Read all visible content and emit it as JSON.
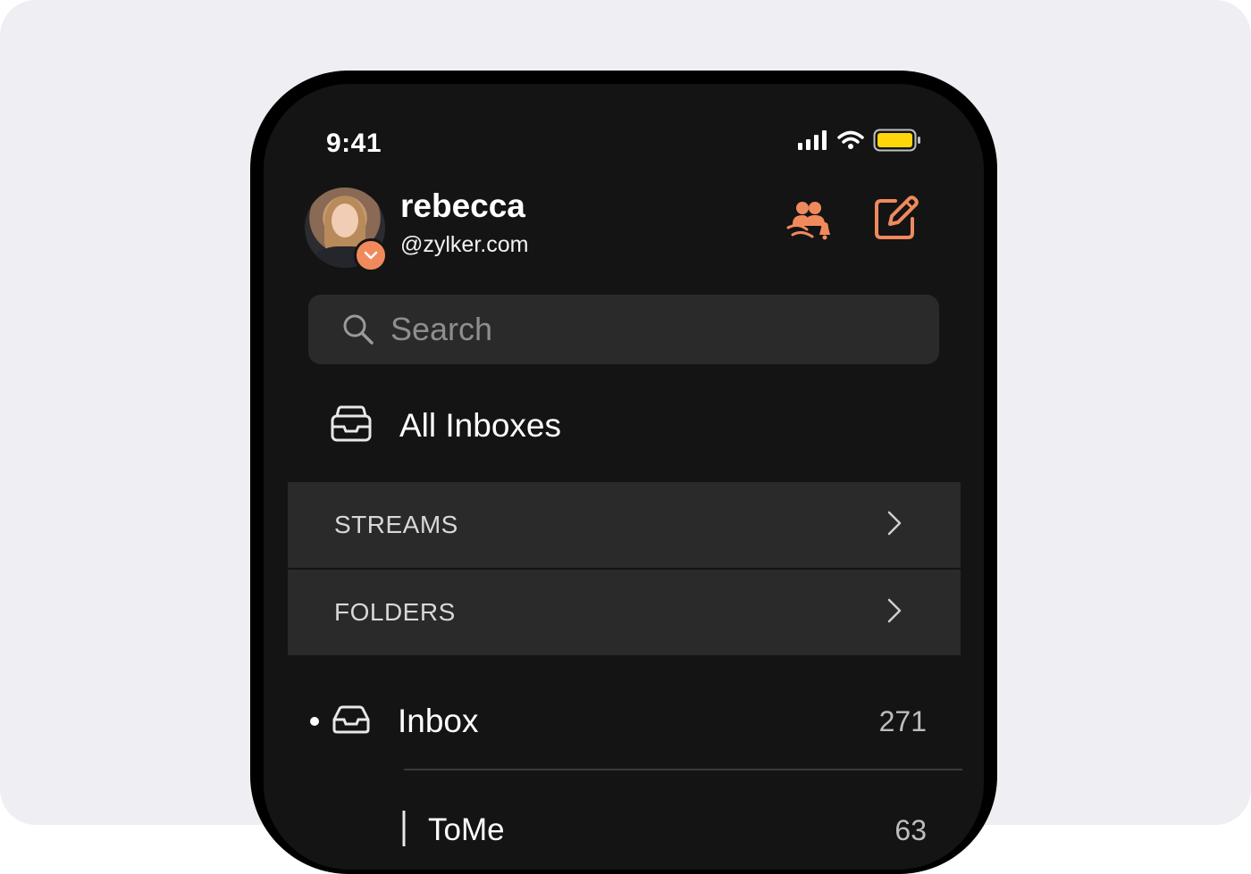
{
  "status_bar": {
    "time": "9:41"
  },
  "account": {
    "name": "rebecca",
    "domain": "@zylker.com"
  },
  "search": {
    "placeholder": "Search"
  },
  "all_inboxes": {
    "label": "All Inboxes"
  },
  "sections": [
    {
      "label": "STREAMS"
    },
    {
      "label": "FOLDERS"
    }
  ],
  "folders": {
    "inbox": {
      "label": "Inbox",
      "count": "271"
    },
    "tome": {
      "label": "ToMe",
      "count": "63"
    }
  },
  "colors": {
    "accent": "#f08a5d",
    "background": "#141414",
    "surface": "#2a2a2a",
    "battery": "#ffd60a"
  },
  "icons": {
    "header_actions": [
      "streams-notification-icon",
      "compose-icon"
    ]
  }
}
